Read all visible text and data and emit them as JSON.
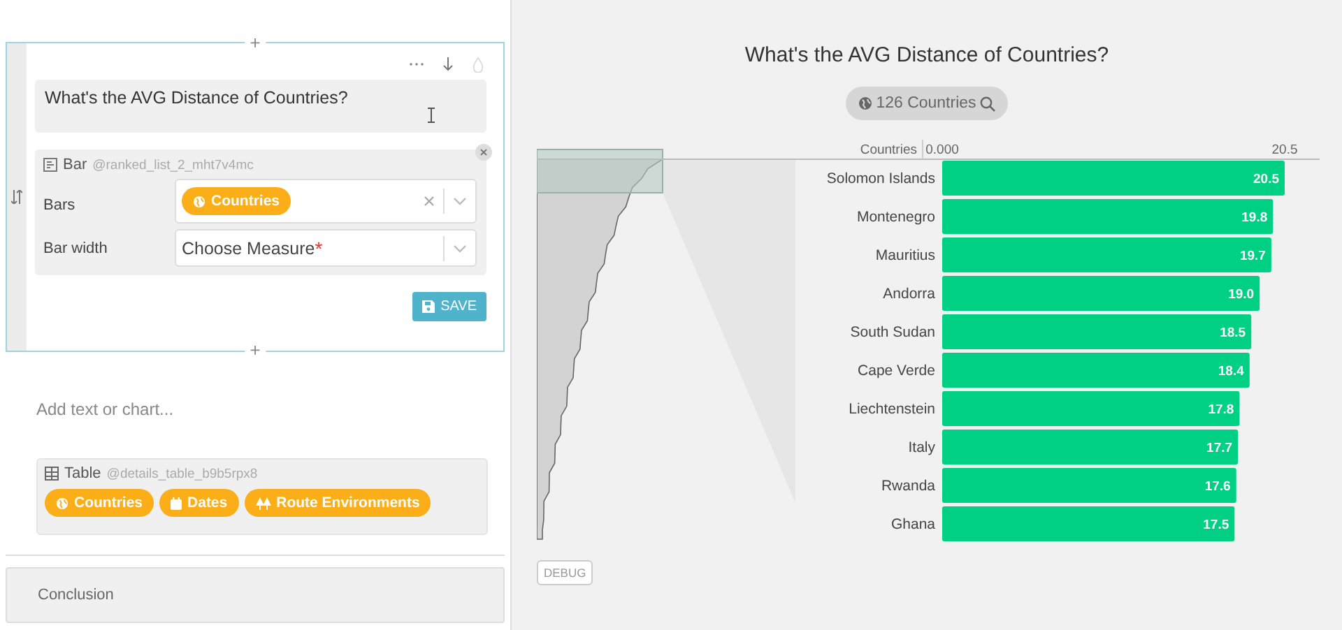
{
  "editor": {
    "question": "What's the AVG Distance of Countries?",
    "block": {
      "type_label": "Bar",
      "id": "@ranked_list_2_mht7v4mc",
      "fields": [
        {
          "label": "Bars",
          "kind": "chips",
          "chips": [
            {
              "label": "Countries",
              "kind": "globe"
            }
          ]
        },
        {
          "label": "Bar width",
          "kind": "select",
          "placeholder": "Choose Measure",
          "required_mark": "*"
        }
      ]
    },
    "save": "SAVE",
    "insert_above": "+",
    "insert_below": "+"
  },
  "add_placeholder": "Add text or chart...",
  "table_block": {
    "type_label": "Table",
    "id": "@details_table_b9b5rpx8",
    "chips": [
      {
        "label": "Countries",
        "kind": "globe"
      },
      {
        "label": "Dates",
        "kind": "calendar"
      },
      {
        "label": "Route Environments",
        "kind": "trees"
      }
    ]
  },
  "conclusion": "Conclusion",
  "chart": {
    "title": "What's the AVG Distance of Countries?",
    "filter": "126 Countries",
    "column_label": "Countries",
    "chart_data": {
      "type": "bar",
      "orientation": "horizontal",
      "categories": [
        "Solomon Islands",
        "Montenegro",
        "Mauritius",
        "Andorra",
        "South Sudan",
        "Cape Verde",
        "Liechtenstein",
        "Italy",
        "Rwanda",
        "Ghana"
      ],
      "series": [
        {
          "color": "#00d084",
          "values": [
            20.5,
            19.8,
            19.7,
            19.0,
            18.5,
            18.4,
            17.8,
            17.7,
            17.6,
            17.5
          ]
        }
      ],
      "xlim": [
        0,
        20.5
      ],
      "xticks": [
        {
          "value": 0,
          "label": "0.000"
        },
        {
          "value": 20.5,
          "label": "20.5"
        }
      ],
      "value_labels": [
        "20.5",
        "19.8",
        "19.7",
        "19.0",
        "18.5",
        "18.4",
        "17.8",
        "17.7",
        "17.6",
        "17.5"
      ]
    }
  },
  "debug": "DEBUG"
}
